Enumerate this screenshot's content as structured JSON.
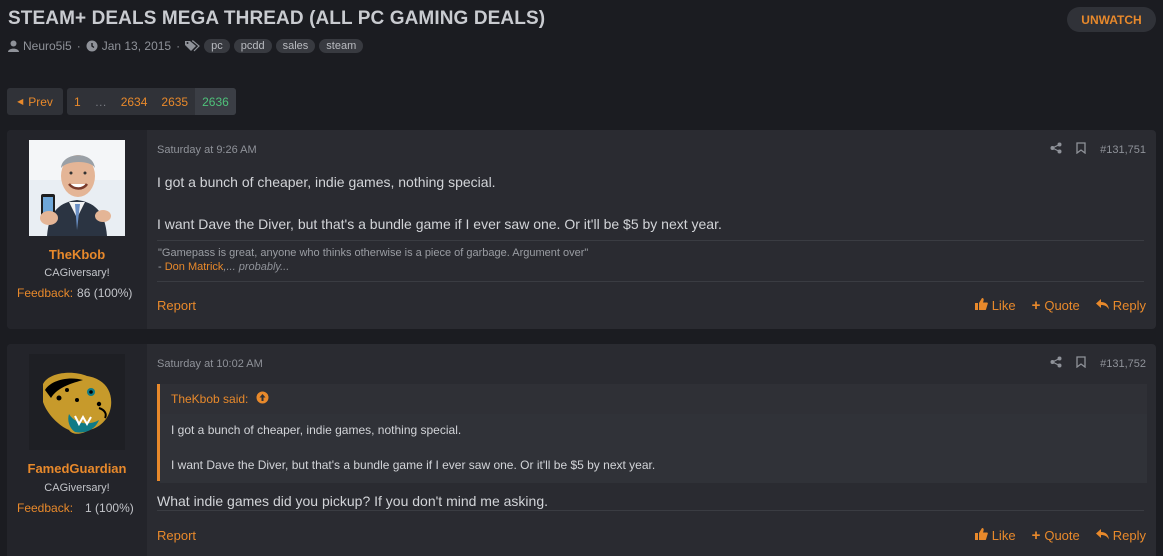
{
  "thread": {
    "title": "STEAM+ DEALS MEGA THREAD (ALL PC GAMING DEALS)",
    "unwatch_label": "UNWATCH",
    "author": "Neuro5i5",
    "date": "Jan 13, 2015",
    "tags": [
      "pc",
      "pcdd",
      "sales",
      "steam"
    ]
  },
  "pagination": {
    "prev_label": "Prev",
    "pages": [
      "1",
      "…",
      "2634",
      "2635",
      "2636"
    ],
    "current": "2636"
  },
  "posts": [
    {
      "username": "TheKbob",
      "user_title": "CAGiversary!",
      "feedback_label": "Feedback:",
      "feedback_value": "86 (100%)",
      "date": "Saturday at 9:26 AM",
      "number": "#131,751",
      "lines": [
        "I got a bunch of cheaper, indie games, nothing special.",
        "I want Dave the Diver, but that's a bundle game if I ever saw one. Or it'll be $5 by next year."
      ],
      "signature": {
        "quote": "\"Gamepass is great, anyone who thinks otherwise is a piece of garbage. Argument over\"",
        "attribution_prefix": "- ",
        "attribution_name": "Don Matrick",
        "attribution_suffix": ",... probably..."
      }
    },
    {
      "username": "FamedGuardian",
      "user_title": "CAGiversary!",
      "feedback_label": "Feedback:",
      "feedback_value": "1 (100%)",
      "date": "Saturday at 10:02 AM",
      "number": "#131,752",
      "quote_header": "TheKbob said:",
      "quote_lines": [
        "I got a bunch of cheaper, indie games, nothing special.",
        "I want Dave the Diver, but that's a bundle game if I ever saw one. Or it'll be $5 by next year."
      ],
      "lines": [
        "What indie games did you pickup? If you don't mind me asking."
      ]
    }
  ],
  "actions": {
    "report": "Report",
    "like": "Like",
    "quote": "Quote",
    "reply": "Reply"
  },
  "colors": {
    "accent": "#e8892b",
    "background": "#1b1c21",
    "post_bg": "#2a2b31",
    "current_page": "#4fc17a"
  },
  "icons": [
    "user-icon",
    "clock-icon",
    "tags-icon",
    "share-icon",
    "bookmark-icon",
    "thumbs-up-icon",
    "plus-icon",
    "reply-icon",
    "arrow-up-circle-icon",
    "caret-left-icon"
  ]
}
